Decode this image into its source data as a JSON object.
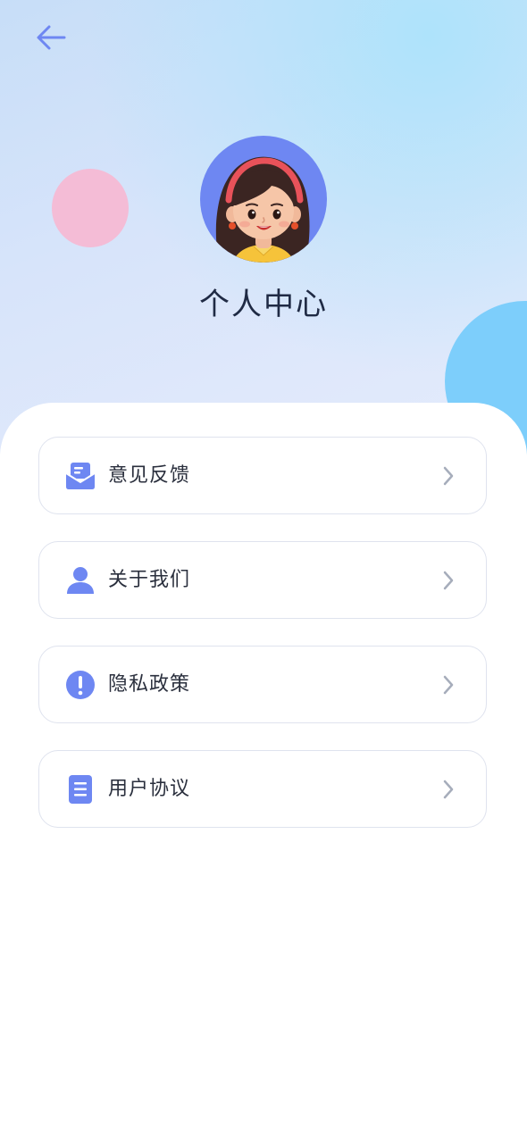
{
  "header": {
    "title": "个人中心",
    "back_icon": "arrow-left-icon",
    "accent_color": "#6e87f2"
  },
  "menu": {
    "items": [
      {
        "id": "feedback",
        "label": "意见反馈",
        "icon": "mail-icon"
      },
      {
        "id": "about",
        "label": "关于我们",
        "icon": "user-icon"
      },
      {
        "id": "privacy",
        "label": "隐私政策",
        "icon": "exclamation-circle-icon"
      },
      {
        "id": "agreement",
        "label": "用户协议",
        "icon": "document-icon"
      }
    ],
    "chevron_icon": "chevron-right-icon"
  }
}
